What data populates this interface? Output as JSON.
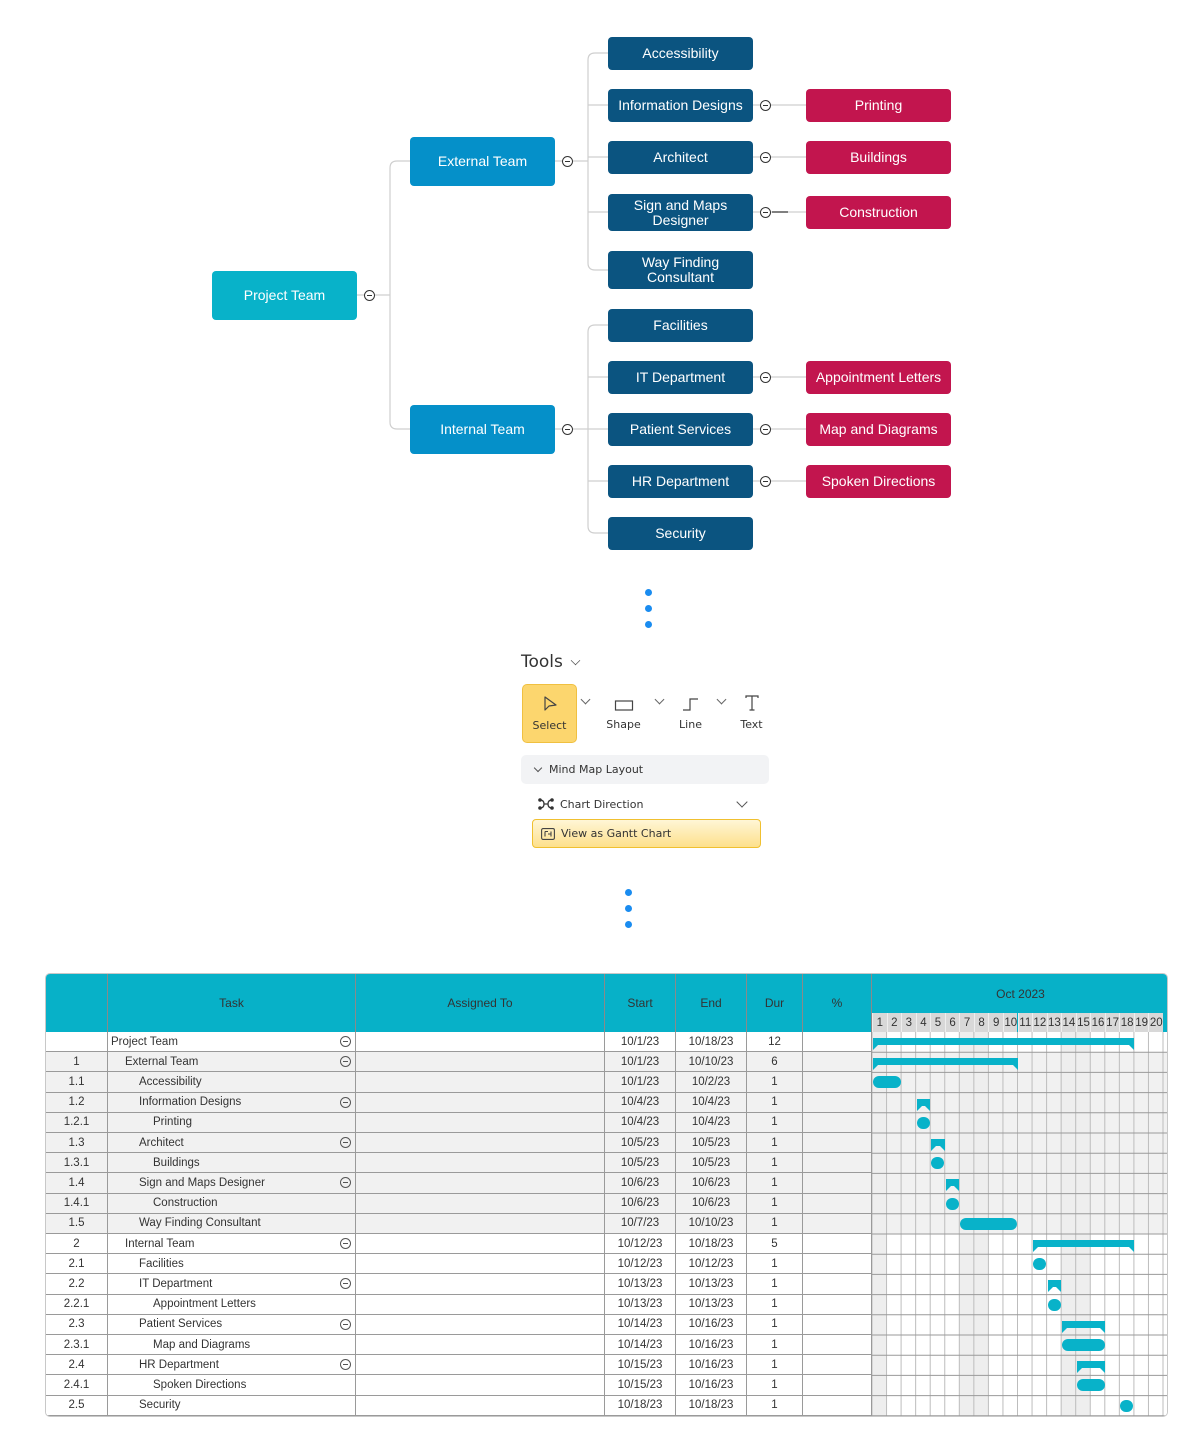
{
  "mindmap": {
    "root": {
      "label": "Project Team"
    },
    "external": {
      "label": "External Team",
      "children": [
        {
          "label": "Accessibility",
          "child": null
        },
        {
          "label": "Information Designs",
          "child": "Printing"
        },
        {
          "label": "Architect",
          "child": "Buildings"
        },
        {
          "label": "Sign and Maps Designer",
          "child": "Construction"
        },
        {
          "label": "Way Finding Consultant",
          "child": null
        }
      ]
    },
    "internal": {
      "label": "Internal Team",
      "children": [
        {
          "label": "Facilities",
          "child": null
        },
        {
          "label": "IT Department",
          "child": "Appointment Letters"
        },
        {
          "label": "Patient Services",
          "child": "Map and Diagrams"
        },
        {
          "label": "HR Department",
          "child": "Spoken Directions"
        },
        {
          "label": "Security",
          "child": null
        }
      ]
    },
    "colors": {
      "root": "#08b2c9",
      "level1": "#0590c9",
      "level2": "#0b5480",
      "level3": "#c2154e"
    }
  },
  "tools": {
    "title": "Tools",
    "items": [
      {
        "label": "Select",
        "icon": "cursor-arrow-icon",
        "active": true
      },
      {
        "label": "Shape",
        "icon": "rectangle-icon",
        "active": false
      },
      {
        "label": "Line",
        "icon": "step-line-icon",
        "active": false
      },
      {
        "label": "Text",
        "icon": "text-t-icon",
        "active": false
      }
    ],
    "section_label": "Mind Map Layout",
    "chart_direction_label": "Chart Direction",
    "gantt_button_label": "View as Gantt Chart"
  },
  "gantt": {
    "columns": {
      "id": "",
      "task": "Task",
      "assigned": "Assigned To",
      "start": "Start",
      "end": "End",
      "dur": "Dur",
      "pct": "%"
    },
    "month": "Oct 2023",
    "days": [
      1,
      2,
      3,
      4,
      5,
      6,
      7,
      8,
      9,
      10,
      11,
      12,
      13,
      14,
      15,
      16,
      17,
      18,
      19,
      20
    ],
    "weekend_days": [
      1,
      7,
      8,
      14,
      15
    ],
    "accent_color": "#08b2c9",
    "rows": [
      {
        "id": "",
        "task": "Project Team",
        "level": 0,
        "collapsible": true,
        "assigned": "",
        "start": "10/1/23",
        "end": "10/18/23",
        "dur": "12",
        "pct_filled": true,
        "bar_start": 1,
        "bar_end": 18,
        "summary": true
      },
      {
        "id": "1",
        "task": "External Team",
        "level": 1,
        "collapsible": true,
        "assigned": "",
        "start": "10/1/23",
        "end": "10/10/23",
        "dur": "6",
        "pct_filled": true,
        "bar_start": 1,
        "bar_end": 10,
        "summary": true
      },
      {
        "id": "1.1",
        "task": "Accessibility",
        "level": 2,
        "collapsible": false,
        "assigned": "",
        "start": "10/1/23",
        "end": "10/2/23",
        "dur": "1",
        "pct_filled": false,
        "bar_start": 1,
        "bar_end": 2,
        "summary": false
      },
      {
        "id": "1.2",
        "task": "Information Designs",
        "level": 2,
        "collapsible": true,
        "assigned": "",
        "start": "10/4/23",
        "end": "10/4/23",
        "dur": "1",
        "pct_filled": true,
        "bar_start": 4,
        "bar_end": 4,
        "summary": true
      },
      {
        "id": "1.2.1",
        "task": "Printing",
        "level": 3,
        "collapsible": false,
        "assigned": "",
        "start": "10/4/23",
        "end": "10/4/23",
        "dur": "1",
        "pct_filled": false,
        "bar_start": 4,
        "bar_end": 4,
        "summary": false
      },
      {
        "id": "1.3",
        "task": "Architect",
        "level": 2,
        "collapsible": true,
        "assigned": "",
        "start": "10/5/23",
        "end": "10/5/23",
        "dur": "1",
        "pct_filled": true,
        "bar_start": 5,
        "bar_end": 5,
        "summary": true
      },
      {
        "id": "1.3.1",
        "task": "Buildings",
        "level": 3,
        "collapsible": false,
        "assigned": "",
        "start": "10/5/23",
        "end": "10/5/23",
        "dur": "1",
        "pct_filled": false,
        "bar_start": 5,
        "bar_end": 5,
        "summary": false
      },
      {
        "id": "1.4",
        "task": "Sign and Maps Designer",
        "level": 2,
        "collapsible": true,
        "assigned": "",
        "start": "10/6/23",
        "end": "10/6/23",
        "dur": "1",
        "pct_filled": true,
        "bar_start": 6,
        "bar_end": 6,
        "summary": true
      },
      {
        "id": "1.4.1",
        "task": "Construction",
        "level": 3,
        "collapsible": false,
        "assigned": "",
        "start": "10/6/23",
        "end": "10/6/23",
        "dur": "1",
        "pct_filled": false,
        "bar_start": 6,
        "bar_end": 6,
        "summary": false
      },
      {
        "id": "1.5",
        "task": "Way Finding Consultant",
        "level": 2,
        "collapsible": false,
        "assigned": "",
        "start": "10/7/23",
        "end": "10/10/23",
        "dur": "1",
        "pct_filled": false,
        "bar_start": 7,
        "bar_end": 10,
        "summary": false
      },
      {
        "id": "2",
        "task": "Internal Team",
        "level": 1,
        "collapsible": true,
        "assigned": "",
        "start": "10/12/23",
        "end": "10/18/23",
        "dur": "5",
        "pct_filled": true,
        "bar_start": 12,
        "bar_end": 18,
        "summary": true
      },
      {
        "id": "2.1",
        "task": "Facilities",
        "level": 2,
        "collapsible": false,
        "assigned": "",
        "start": "10/12/23",
        "end": "10/12/23",
        "dur": "1",
        "pct_filled": false,
        "bar_start": 12,
        "bar_end": 12,
        "summary": false
      },
      {
        "id": "2.2",
        "task": "IT Department",
        "level": 2,
        "collapsible": true,
        "assigned": "",
        "start": "10/13/23",
        "end": "10/13/23",
        "dur": "1",
        "pct_filled": true,
        "bar_start": 13,
        "bar_end": 13,
        "summary": true
      },
      {
        "id": "2.2.1",
        "task": "Appointment Letters",
        "level": 3,
        "collapsible": false,
        "assigned": "",
        "start": "10/13/23",
        "end": "10/13/23",
        "dur": "1",
        "pct_filled": false,
        "bar_start": 13,
        "bar_end": 13,
        "summary": false
      },
      {
        "id": "2.3",
        "task": "Patient Services",
        "level": 2,
        "collapsible": true,
        "assigned": "",
        "start": "10/14/23",
        "end": "10/16/23",
        "dur": "1",
        "pct_filled": true,
        "bar_start": 14,
        "bar_end": 16,
        "summary": true
      },
      {
        "id": "2.3.1",
        "task": "Map and Diagrams",
        "level": 3,
        "collapsible": false,
        "assigned": "",
        "start": "10/14/23",
        "end": "10/16/23",
        "dur": "1",
        "pct_filled": false,
        "bar_start": 14,
        "bar_end": 16,
        "summary": false
      },
      {
        "id": "2.4",
        "task": "HR Department",
        "level": 2,
        "collapsible": true,
        "assigned": "",
        "start": "10/15/23",
        "end": "10/16/23",
        "dur": "1",
        "pct_filled": true,
        "bar_start": 15,
        "bar_end": 16,
        "summary": true
      },
      {
        "id": "2.4.1",
        "task": "Spoken Directions",
        "level": 3,
        "collapsible": false,
        "assigned": "",
        "start": "10/15/23",
        "end": "10/16/23",
        "dur": "1",
        "pct_filled": false,
        "bar_start": 15,
        "bar_end": 16,
        "summary": false
      },
      {
        "id": "2.5",
        "task": "Security",
        "level": 2,
        "collapsible": false,
        "assigned": "",
        "start": "10/18/23",
        "end": "10/18/23",
        "dur": "1",
        "pct_filled": false,
        "bar_start": 18,
        "bar_end": 18,
        "summary": false
      }
    ]
  }
}
